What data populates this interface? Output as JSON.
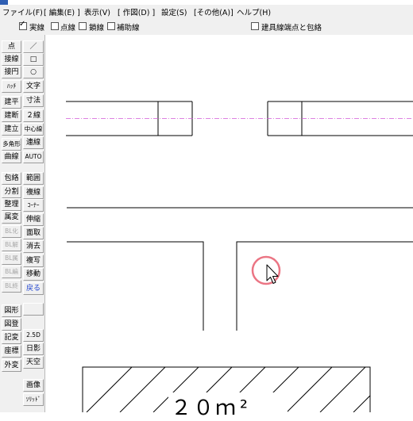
{
  "menubar": {
    "items": [
      "ファイル(F)",
      "[ 編集(E) ]",
      "表示(V)",
      "[ 作図(D) ]",
      "設定(S)",
      "[その他(A)]",
      "ヘルプ(H)"
    ]
  },
  "options": {
    "line_types": [
      {
        "label": "実線",
        "checked": true
      },
      {
        "label": "点線",
        "checked": false
      },
      {
        "label": "鎖線",
        "checked": false
      },
      {
        "label": "補助線",
        "checked": false
      }
    ],
    "endpoint_option": {
      "label": "建具線端点と包絡",
      "checked": false
    }
  },
  "toolbar": {
    "left_column": [
      {
        "label": "点",
        "state": "normal"
      },
      {
        "label": "接線",
        "state": "normal"
      },
      {
        "label": "接円",
        "state": "normal"
      },
      {
        "label": "ﾊｯﾁ",
        "state": "normal"
      },
      {
        "label": "建平",
        "state": "normal"
      },
      {
        "label": "建断",
        "state": "normal"
      },
      {
        "label": "建立",
        "state": "normal"
      },
      {
        "label": "多角形",
        "state": "normal"
      },
      {
        "label": "曲線",
        "state": "normal"
      },
      {
        "label": "包絡",
        "state": "normal"
      },
      {
        "label": "分割",
        "state": "normal"
      },
      {
        "label": "整理",
        "state": "normal"
      },
      {
        "label": "属変",
        "state": "normal"
      },
      {
        "label": "BL化",
        "state": "disabled"
      },
      {
        "label": "BL解",
        "state": "disabled"
      },
      {
        "label": "BL属",
        "state": "disabled"
      },
      {
        "label": "BL編",
        "state": "disabled"
      },
      {
        "label": "BL終",
        "state": "disabled"
      },
      {
        "label": "図形",
        "state": "normal"
      },
      {
        "label": "図登",
        "state": "normal"
      },
      {
        "label": "記変",
        "state": "normal"
      },
      {
        "label": "座標",
        "state": "normal"
      },
      {
        "label": "外変",
        "state": "normal"
      }
    ],
    "right_column": [
      {
        "label": "／",
        "state": "normal"
      },
      {
        "label": "□",
        "state": "normal"
      },
      {
        "label": "○",
        "state": "normal"
      },
      {
        "label": "文字",
        "state": "normal"
      },
      {
        "label": "寸法",
        "state": "normal"
      },
      {
        "label": "２線",
        "state": "normal"
      },
      {
        "label": "中心線",
        "state": "normal"
      },
      {
        "label": "連線",
        "state": "normal"
      },
      {
        "label": "AUTO",
        "state": "normal"
      },
      {
        "label": "範囲",
        "state": "normal"
      },
      {
        "label": "複線",
        "state": "normal"
      },
      {
        "label": "ｺｰﾅｰ",
        "state": "normal"
      },
      {
        "label": "伸縮",
        "state": "normal"
      },
      {
        "label": "面取",
        "state": "normal"
      },
      {
        "label": "消去",
        "state": "normal"
      },
      {
        "label": "複写",
        "state": "normal"
      },
      {
        "label": "移動",
        "state": "normal"
      },
      {
        "label": "戻る",
        "state": "active"
      },
      {
        "label": "",
        "state": "normal"
      },
      {
        "label": "2.5D",
        "state": "normal"
      },
      {
        "label": "日影",
        "state": "normal"
      },
      {
        "label": "天空",
        "state": "normal"
      },
      {
        "label": "画像",
        "state": "normal"
      },
      {
        "label": "ｿﾘｯﾄﾞ",
        "state": "normal"
      }
    ]
  },
  "drawing": {
    "area_label": "２０ｍ²",
    "colors": {
      "center_line": "#d25ad8",
      "cursor_ring": "#e85d6e",
      "line": "#000000"
    }
  }
}
